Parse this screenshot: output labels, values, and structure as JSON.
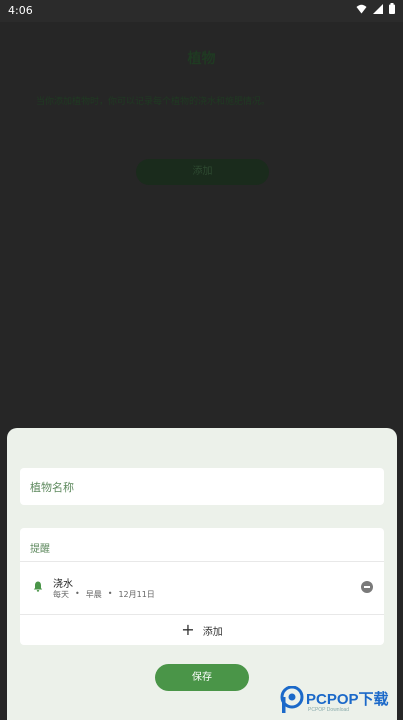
{
  "status": {
    "time": "4:06"
  },
  "background": {
    "title": "植物",
    "description": "当你添加植物时，你可以记录每个植物的浇水和施肥情况。",
    "add_label": "添加"
  },
  "sheet": {
    "name_placeholder": "植物名称",
    "reminders_header": "提醒",
    "reminder": {
      "title": "浇水",
      "frequency": "每天",
      "time_of_day": "早晨",
      "date": "12月11日",
      "sep": "•"
    },
    "add_label": "添加",
    "save_label": "保存"
  },
  "watermark": {
    "text": "PCPOP下载",
    "sub": "PCPOP Download"
  },
  "colors": {
    "accent": "#4a9548",
    "label": "#5f8a5f",
    "sheet_bg": "#ecf1ea"
  }
}
